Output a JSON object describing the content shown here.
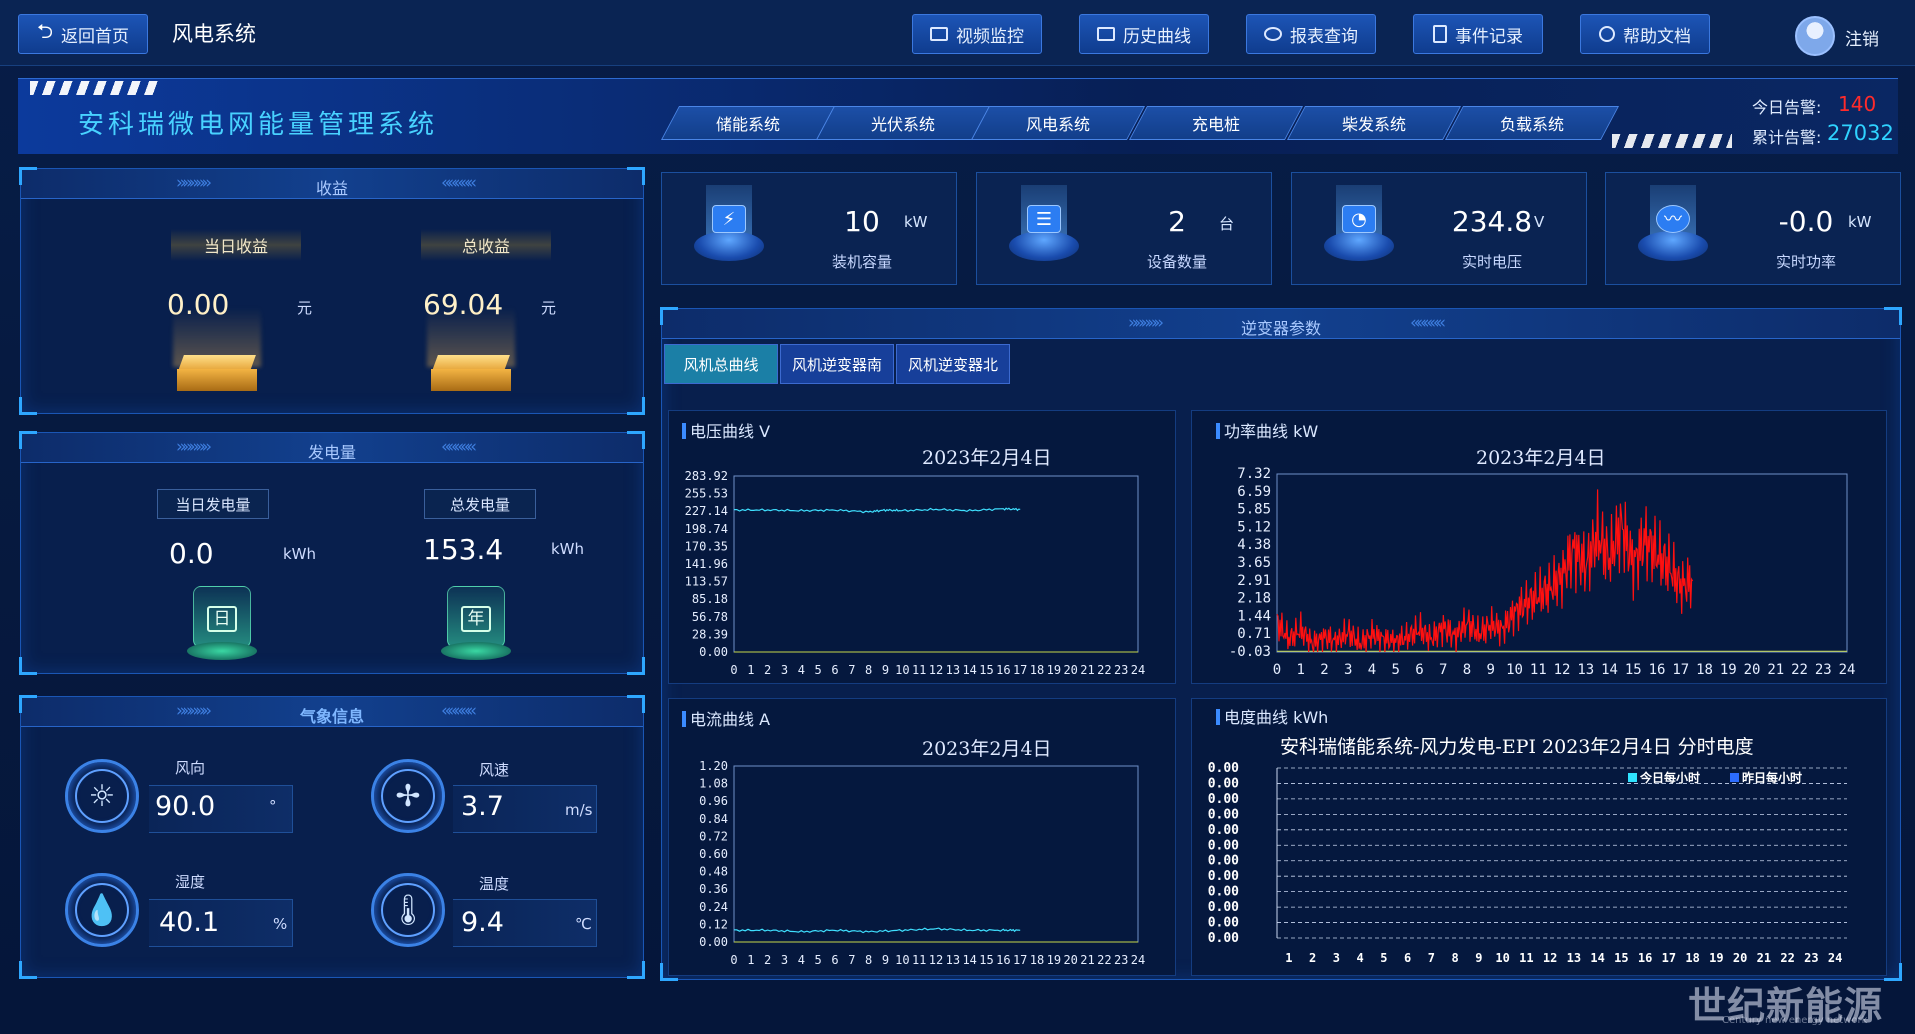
{
  "header": {
    "home_label": "返回首页",
    "page_name": "风电系统",
    "buttons": [
      "视频监控",
      "历史曲线",
      "报表查询",
      "事件记录",
      "帮助文档"
    ],
    "logout_label": "注销"
  },
  "system_title": "安科瑞微电网能量管理系统",
  "nav_tabs": [
    "储能系统",
    "光伏系统",
    "风电系统",
    "充电桩",
    "柴发系统",
    "负载系统"
  ],
  "alarms": {
    "today_label": "今日告警:",
    "today": "140",
    "total_label": "累计告警:",
    "total": "27032"
  },
  "income": {
    "title": "收益",
    "today_label": "当日收益",
    "today_value": "0.00",
    "today_unit": "元",
    "total_label": "总收益",
    "total_value": "69.04",
    "total_unit": "元"
  },
  "generation": {
    "title": "发电量",
    "today_label": "当日发电量",
    "today_value": "0.0",
    "today_unit": "kWh",
    "today_glyph": "日",
    "total_label": "总发电量",
    "total_value": "153.4",
    "total_unit": "kWh",
    "total_glyph": "年"
  },
  "weather": {
    "title": "气象信息",
    "items": [
      {
        "label": "风向",
        "value": "90.0",
        "unit": "°",
        "icon": "wind-direction-icon"
      },
      {
        "label": "风速",
        "value": "3.7",
        "unit": "m/s",
        "icon": "fan-icon"
      },
      {
        "label": "湿度",
        "value": "40.1",
        "unit": "%",
        "icon": "humidity-icon"
      },
      {
        "label": "温度",
        "value": "9.4",
        "unit": "℃",
        "icon": "thermometer-icon"
      }
    ]
  },
  "stats": [
    {
      "value": "10",
      "unit": "kW",
      "label": "装机容量",
      "icon": "battery-icon"
    },
    {
      "value": "2",
      "unit": "台",
      "label": "设备数量",
      "icon": "server-icon"
    },
    {
      "value": "234.8",
      "unit": "V",
      "label": "实时电压",
      "icon": "gauge-icon"
    },
    {
      "value": "-0.0",
      "unit": "kW",
      "label": "实时功率",
      "icon": "pulse-icon"
    }
  ],
  "inverter": {
    "title": "逆变器参数",
    "tabs": [
      "风机总曲线",
      "风机逆变器南",
      "风机逆变器北"
    ],
    "active_tab": 0
  },
  "charts": {
    "voltage": {
      "title": "电压曲线  V",
      "date": "2023年2月4日"
    },
    "power": {
      "title": "功率曲线  kW",
      "date": "2023年2月4日"
    },
    "current": {
      "title": "电流曲线  A",
      "date": "2023年2月4日"
    },
    "energy": {
      "title": "电度曲线  kWh",
      "heading": "安科瑞储能系统-风力发电-EPI 2023年2月4日 分时电度",
      "legend_today": "今日每小时",
      "legend_yesterday": "昨日每小时"
    }
  },
  "chart_data": [
    {
      "type": "line",
      "ylabel": "V",
      "yticks": [
        "283.92",
        "255.53",
        "227.14",
        "198.74",
        "170.35",
        "141.96",
        "113.57",
        "85.18",
        "56.78",
        "28.39",
        "0.00"
      ],
      "ylim": [
        0,
        283.92
      ],
      "xlim": [
        0,
        24
      ],
      "xticks": [
        "0",
        "1",
        "2",
        "3",
        "4",
        "5",
        "6",
        "7",
        "8",
        "9",
        "10",
        "11",
        "12",
        "13",
        "14",
        "15",
        "16",
        "17",
        "18",
        "19",
        "20",
        "21",
        "22",
        "23",
        "24"
      ],
      "series": [
        {
          "color": "#3fe0ff",
          "x": [
            0,
            2,
            4,
            6,
            8,
            9,
            10,
            12,
            14,
            16,
            17
          ],
          "y": [
            229,
            229,
            228,
            229,
            226,
            229,
            228,
            230,
            228,
            231,
            230
          ]
        }
      ]
    },
    {
      "type": "line",
      "ylabel": "kW",
      "yticks": [
        "7.32",
        "6.59",
        "5.85",
        "5.12",
        "4.38",
        "3.65",
        "2.91",
        "2.18",
        "1.44",
        "0.71",
        "-0.03"
      ],
      "ylim": [
        -0.03,
        7.32
      ],
      "xlim": [
        0,
        24
      ],
      "xticks": [
        "0",
        "1",
        "2",
        "3",
        "4",
        "5",
        "6",
        "7",
        "8",
        "9",
        "10",
        "11",
        "12",
        "13",
        "14",
        "15",
        "16",
        "17",
        "18",
        "19",
        "20",
        "21",
        "22",
        "23",
        "24"
      ],
      "series": [
        {
          "color": "#ff1010",
          "x": [
            0,
            0.5,
            1,
            1.5,
            2,
            2.5,
            3,
            3.5,
            4,
            4.5,
            5,
            5.5,
            6,
            6.5,
            7,
            7.5,
            8,
            8.5,
            9,
            9.5,
            10,
            10.5,
            11,
            11.5,
            12,
            12.5,
            13,
            13.5,
            14,
            14.5,
            15,
            15.5,
            16,
            16.5,
            17,
            17.5
          ],
          "y": [
            1.2,
            0.5,
            0.9,
            0.3,
            0.6,
            0.4,
            0.8,
            0.3,
            0.7,
            0.5,
            0.4,
            0.6,
            0.9,
            0.5,
            1.0,
            0.6,
            1.2,
            0.7,
            1.1,
            0.9,
            1.6,
            2.0,
            2.3,
            2.6,
            3.1,
            4.2,
            3.5,
            4.8,
            3.8,
            5.2,
            3.6,
            4.6,
            4.0,
            3.5,
            2.7,
            2.9
          ]
        }
      ]
    },
    {
      "type": "line",
      "ylabel": "A",
      "yticks": [
        "1.20",
        "1.08",
        "0.96",
        "0.84",
        "0.72",
        "0.60",
        "0.48",
        "0.36",
        "0.24",
        "0.12",
        "0.00"
      ],
      "ylim": [
        0,
        1.2
      ],
      "xlim": [
        0,
        24
      ],
      "xticks": [
        "0",
        "1",
        "2",
        "3",
        "4",
        "5",
        "6",
        "7",
        "8",
        "9",
        "10",
        "11",
        "12",
        "13",
        "14",
        "15",
        "16",
        "17",
        "18",
        "19",
        "20",
        "21",
        "22",
        "23",
        "24"
      ],
      "series": [
        {
          "color": "#3fe0ff",
          "x": [
            0,
            2,
            4,
            6,
            8,
            10,
            12,
            14,
            16,
            17
          ],
          "y": [
            0.08,
            0.08,
            0.07,
            0.08,
            0.07,
            0.08,
            0.09,
            0.08,
            0.08,
            0.08
          ]
        }
      ]
    },
    {
      "type": "bar",
      "yticks": [
        "0.00",
        "0.00",
        "0.00",
        "0.00",
        "0.00",
        "0.00",
        "0.00",
        "0.00",
        "0.00",
        "0.00",
        "0.00",
        "0.00"
      ],
      "categories": [
        "1",
        "2",
        "3",
        "4",
        "5",
        "6",
        "7",
        "8",
        "9",
        "10",
        "11",
        "12",
        "13",
        "14",
        "15",
        "16",
        "17",
        "18",
        "19",
        "20",
        "21",
        "22",
        "23",
        "24"
      ],
      "series": [
        {
          "name": "今日每小时",
          "color": "#2fe3ff",
          "values": [
            0,
            0,
            0,
            0,
            0,
            0,
            0,
            0,
            0,
            0,
            0,
            0,
            0,
            0,
            0,
            0,
            0,
            0,
            0,
            0,
            0,
            0,
            0,
            0
          ]
        },
        {
          "name": "昨日每小时",
          "color": "#2c6cff",
          "values": [
            0,
            0,
            0,
            0,
            0,
            0,
            0,
            0,
            0,
            0,
            0,
            0,
            0,
            0,
            0,
            0,
            0,
            0,
            0,
            0,
            0,
            0,
            0,
            0
          ]
        }
      ]
    }
  ],
  "watermark": {
    "main": "世纪新能源网",
    "sub": "Century new energy network"
  }
}
